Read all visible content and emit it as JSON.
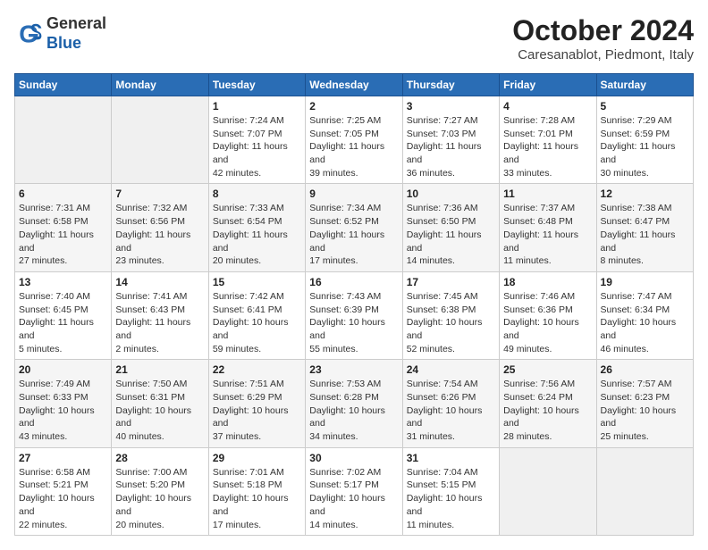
{
  "header": {
    "logo_line1": "General",
    "logo_line2": "Blue",
    "month": "October 2024",
    "location": "Caresanablot, Piedmont, Italy"
  },
  "days_of_week": [
    "Sunday",
    "Monday",
    "Tuesday",
    "Wednesday",
    "Thursday",
    "Friday",
    "Saturday"
  ],
  "weeks": [
    [
      {
        "day": null
      },
      {
        "day": null
      },
      {
        "day": "1",
        "sunrise": "7:24 AM",
        "sunset": "7:07 PM",
        "daylight": "11 hours and 42 minutes."
      },
      {
        "day": "2",
        "sunrise": "7:25 AM",
        "sunset": "7:05 PM",
        "daylight": "11 hours and 39 minutes."
      },
      {
        "day": "3",
        "sunrise": "7:27 AM",
        "sunset": "7:03 PM",
        "daylight": "11 hours and 36 minutes."
      },
      {
        "day": "4",
        "sunrise": "7:28 AM",
        "sunset": "7:01 PM",
        "daylight": "11 hours and 33 minutes."
      },
      {
        "day": "5",
        "sunrise": "7:29 AM",
        "sunset": "6:59 PM",
        "daylight": "11 hours and 30 minutes."
      }
    ],
    [
      {
        "day": "6",
        "sunrise": "7:31 AM",
        "sunset": "6:58 PM",
        "daylight": "11 hours and 27 minutes."
      },
      {
        "day": "7",
        "sunrise": "7:32 AM",
        "sunset": "6:56 PM",
        "daylight": "11 hours and 23 minutes."
      },
      {
        "day": "8",
        "sunrise": "7:33 AM",
        "sunset": "6:54 PM",
        "daylight": "11 hours and 20 minutes."
      },
      {
        "day": "9",
        "sunrise": "7:34 AM",
        "sunset": "6:52 PM",
        "daylight": "11 hours and 17 minutes."
      },
      {
        "day": "10",
        "sunrise": "7:36 AM",
        "sunset": "6:50 PM",
        "daylight": "11 hours and 14 minutes."
      },
      {
        "day": "11",
        "sunrise": "7:37 AM",
        "sunset": "6:48 PM",
        "daylight": "11 hours and 11 minutes."
      },
      {
        "day": "12",
        "sunrise": "7:38 AM",
        "sunset": "6:47 PM",
        "daylight": "11 hours and 8 minutes."
      }
    ],
    [
      {
        "day": "13",
        "sunrise": "7:40 AM",
        "sunset": "6:45 PM",
        "daylight": "11 hours and 5 minutes."
      },
      {
        "day": "14",
        "sunrise": "7:41 AM",
        "sunset": "6:43 PM",
        "daylight": "11 hours and 2 minutes."
      },
      {
        "day": "15",
        "sunrise": "7:42 AM",
        "sunset": "6:41 PM",
        "daylight": "10 hours and 59 minutes."
      },
      {
        "day": "16",
        "sunrise": "7:43 AM",
        "sunset": "6:39 PM",
        "daylight": "10 hours and 55 minutes."
      },
      {
        "day": "17",
        "sunrise": "7:45 AM",
        "sunset": "6:38 PM",
        "daylight": "10 hours and 52 minutes."
      },
      {
        "day": "18",
        "sunrise": "7:46 AM",
        "sunset": "6:36 PM",
        "daylight": "10 hours and 49 minutes."
      },
      {
        "day": "19",
        "sunrise": "7:47 AM",
        "sunset": "6:34 PM",
        "daylight": "10 hours and 46 minutes."
      }
    ],
    [
      {
        "day": "20",
        "sunrise": "7:49 AM",
        "sunset": "6:33 PM",
        "daylight": "10 hours and 43 minutes."
      },
      {
        "day": "21",
        "sunrise": "7:50 AM",
        "sunset": "6:31 PM",
        "daylight": "10 hours and 40 minutes."
      },
      {
        "day": "22",
        "sunrise": "7:51 AM",
        "sunset": "6:29 PM",
        "daylight": "10 hours and 37 minutes."
      },
      {
        "day": "23",
        "sunrise": "7:53 AM",
        "sunset": "6:28 PM",
        "daylight": "10 hours and 34 minutes."
      },
      {
        "day": "24",
        "sunrise": "7:54 AM",
        "sunset": "6:26 PM",
        "daylight": "10 hours and 31 minutes."
      },
      {
        "day": "25",
        "sunrise": "7:56 AM",
        "sunset": "6:24 PM",
        "daylight": "10 hours and 28 minutes."
      },
      {
        "day": "26",
        "sunrise": "7:57 AM",
        "sunset": "6:23 PM",
        "daylight": "10 hours and 25 minutes."
      }
    ],
    [
      {
        "day": "27",
        "sunrise": "6:58 AM",
        "sunset": "5:21 PM",
        "daylight": "10 hours and 22 minutes."
      },
      {
        "day": "28",
        "sunrise": "7:00 AM",
        "sunset": "5:20 PM",
        "daylight": "10 hours and 20 minutes."
      },
      {
        "day": "29",
        "sunrise": "7:01 AM",
        "sunset": "5:18 PM",
        "daylight": "10 hours and 17 minutes."
      },
      {
        "day": "30",
        "sunrise": "7:02 AM",
        "sunset": "5:17 PM",
        "daylight": "10 hours and 14 minutes."
      },
      {
        "day": "31",
        "sunrise": "7:04 AM",
        "sunset": "5:15 PM",
        "daylight": "10 hours and 11 minutes."
      },
      {
        "day": null
      },
      {
        "day": null
      }
    ]
  ],
  "labels": {
    "sunrise": "Sunrise:",
    "sunset": "Sunset:",
    "daylight": "Daylight hours"
  }
}
